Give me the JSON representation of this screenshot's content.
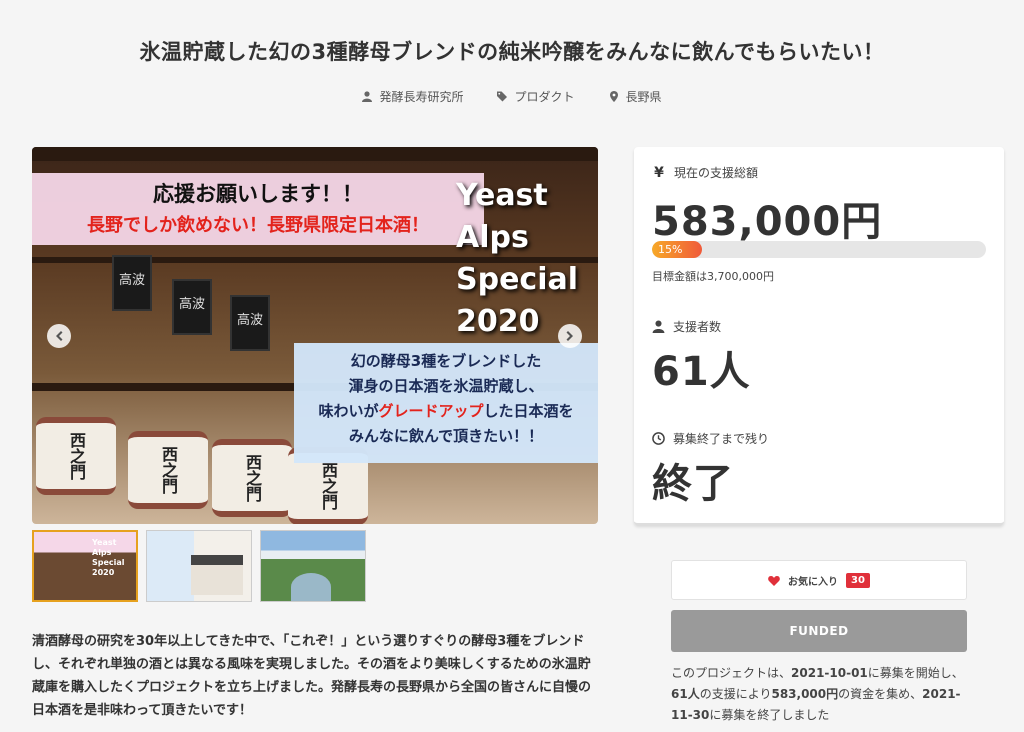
{
  "project": {
    "title": "氷温貯蔵した幻の3種酵母ブレンドの純米吟醸をみんなに飲んでもらいたい！",
    "owner": "発酵長寿研究所",
    "category": "プロダクト",
    "location": "長野県"
  },
  "hero": {
    "banner_line1": "応援お願いします！！",
    "banner_line2": "長野でしか飲めない！長野県限定日本酒！",
    "yeast_lines": [
      "Yeast",
      "Alps",
      "Special",
      "2020"
    ],
    "mid_line1": "幻の酵母3種をブレンドした",
    "mid_line2": "渾身の日本酒を氷温貯蔵し、",
    "mid_line3_pre": "味わいが",
    "mid_line3_red": "グレードアップ",
    "mid_line3_post": "した日本酒を",
    "mid_line4": "みんなに飲んで頂きたい！！",
    "lantern_text": "高波",
    "barrel_text": "西之門"
  },
  "thumb1_text": "Yeast Alps Special 2020",
  "description": "清酒酵母の研究を30年以上してきた中で、「これぞ！」という選りすぐりの酵母3種をブレンドし、それぞれ単独の酒とは異なる風味を実現しました。その酒をより美味しくするための氷温貯蔵庫を購入したくプロジェクトを立ち上げました。発酵長寿の長野県から全国の皆さんに自慢の日本酒を是非味わって頂きたいです！",
  "stats": {
    "amount_label": "現在の支援総額",
    "amount_value": "583,000円",
    "progress_percent": 15,
    "progress_label": "15%",
    "goal_text": "目標金額は3,700,000円",
    "backers_label": "支援者数",
    "backers_value": "61人",
    "remaining_label": "募集終了まで残り",
    "remaining_value": "終了"
  },
  "favorite": {
    "label": "お気に入り",
    "count": "30"
  },
  "funded_label": "FUNDED",
  "summary": {
    "p1": "このプロジェクトは、",
    "start": "2021-10-01",
    "p2": "に募集を開始し、",
    "backers": "61人",
    "p3": "の支援により",
    "amount": "583,000円",
    "p4": "の資金を集め、",
    "end": "2021-11-30",
    "p5": "に募集を終了しました"
  },
  "colors": {
    "accent_red": "#e0303a",
    "progress_start": "#f7a928",
    "progress_end": "#f05a3a",
    "funded_gray": "#9a9a9a"
  }
}
